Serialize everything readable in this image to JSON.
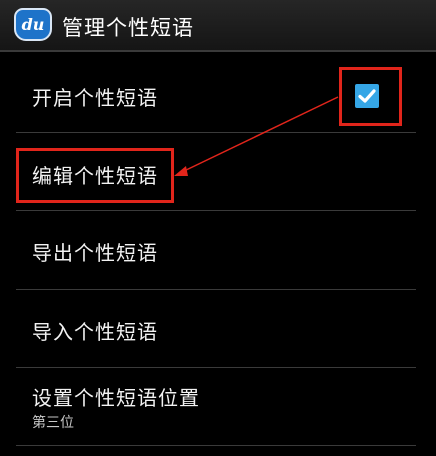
{
  "titlebar": {
    "title": "管理个性短语",
    "app_icon_text": "du"
  },
  "items": [
    {
      "label": "开启个性短语",
      "checked": true
    },
    {
      "label": "编辑个性短语"
    },
    {
      "label": "导出个性短语"
    },
    {
      "label": "导入个性短语"
    },
    {
      "label": "设置个性短语位置",
      "sublabel": "第三位"
    }
  ],
  "colors": {
    "accent": "#35a6e6",
    "annotation": "#e1251b",
    "background": "#000000"
  }
}
